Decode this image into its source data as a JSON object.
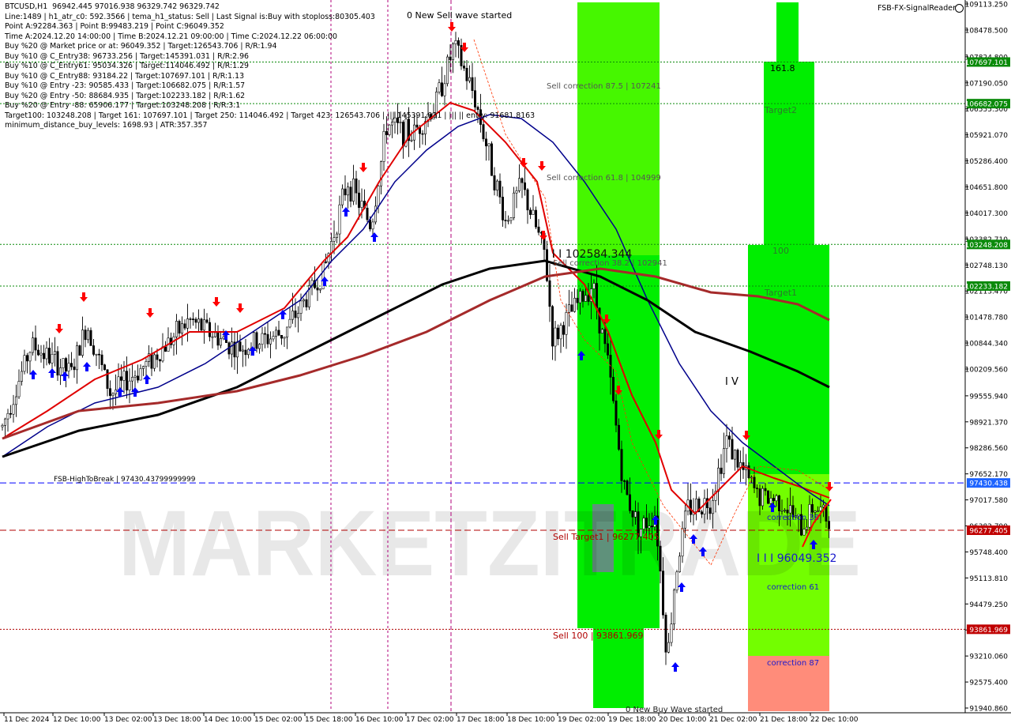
{
  "header": {
    "indicator_name": "FSB-FX-SignalReader",
    "info_lines": [
      "BTCUSD,H1  96942.445 97016.938 96329.742 96329.742",
      "Line:1489 | h1_atr_c0: 592.3566 | tema_h1_status: Sell | Last Signal is:Buy with stoploss:80305.403",
      "Point A:92284.363 | Point B:99483.219 | Point C:96049.352",
      "Time A:2024.12.20 14:00:00 | Time B:2024.12.21 09:00:00 | Time C:2024.12.22 06:00:00",
      "Buy %20 @ Market price or at: 96049.352 | Target:126543.706 | R/R:1.94",
      "Buy %10 @ C_Entry38: 96733.256 | Target:145391.031 | R/R:2.96",
      "Buy %10 @ C_Entry61: 95034.326 | Target:114046.492 | R/R:1.29",
      "Buy %10 @ C_Entry88: 93184.22 | Target:107697.101 | R/R:1.13",
      "Buy %10 @ Entry -23: 90585.433 | Target:106682.075 | R/R:1.57",
      "Buy %20 @ Entry -50: 88684.935 | Target:102233.182 | R/R:1.62",
      "Buy %20 @ Entry -88: 65906.177 | Target:103248.208 | R/R:3.1",
      "Target100: 103248.208 | Target 161: 107697.101 | Target 250: 114046.492 | Target 423: 126543.706 | ||| 145391.031 | ||| || entry: 91681.8163",
      "minimum_distance_buy_levels: 1698.93 | ATR:357.357"
    ],
    "watermark": "MARKETZITRADE"
  },
  "chart_data": {
    "type": "candlestick",
    "symbol": "BTCUSD",
    "timeframe": "H1",
    "price_axis": {
      "ticks": [
        "109113.250",
        "108478.500",
        "107824.800",
        "107190.050",
        "106555.300",
        "105921.070",
        "105286.400",
        "104651.800",
        "104017.300",
        "103382.710",
        "102748.130",
        "102113.470",
        "101478.780",
        "100844.340",
        "100209.560",
        "99555.940",
        "98921.370",
        "98286.560",
        "97652.170",
        "97017.580",
        "96382.790",
        "95748.400",
        "95113.810",
        "94479.250",
        "93844.650",
        "93210.060",
        "92575.400",
        "91940.860"
      ],
      "range": [
        91790,
        109300
      ]
    },
    "time_axis": {
      "labels": [
        "11 Dec 2024",
        "12 Dec 10:00",
        "13 Dec 02:00",
        "13 Dec 18:00",
        "14 Dec 10:00",
        "15 Dec 02:00",
        "15 Dec 18:00",
        "16 Dec 10:00",
        "17 Dec 02:00",
        "17 Dec 18:00",
        "18 Dec 10:00",
        "19 Dec 02:00",
        "19 Dec 18:00",
        "20 Dec 10:00",
        "21 Dec 02:00",
        "21 Dec 18:00",
        "22 Dec 10:00"
      ]
    },
    "levels": [
      {
        "price": 107697.101,
        "label": "107697.101",
        "color": "#0a8a0a",
        "style": "dotted"
      },
      {
        "price": 106682.075,
        "label": "106682.075",
        "color": "#0a8a0a",
        "style": "dotted"
      },
      {
        "price": 103248.208,
        "label": "103248.208",
        "color": "#0a8a0a",
        "style": "dotted"
      },
      {
        "price": 102233.182,
        "label": "102233.182",
        "color": "#0a8a0a",
        "style": "dotted"
      },
      {
        "price": 97430.438,
        "label": "97430.438",
        "color": "#0000ff",
        "style": "dashed"
      },
      {
        "price": 96277.405,
        "label": "96277.405",
        "color": "#b00000",
        "style": "dashed"
      },
      {
        "price": 93861.969,
        "label": "93861.969",
        "color": "#b00000",
        "style": "dotted"
      }
    ],
    "annotations": {
      "new_sell_wave_top": "0 New Sell wave started",
      "new_buy_wave_bottom": "0 New Buy Wave started",
      "sell_correction_875": "Sell correction 87.5 | 107241",
      "sell_correction_618": "Sell correction 61.8 | 104999",
      "sell_correction_382": "Sell correction 38.2 | 102941",
      "wave_iii_label": "I I I  102584.344",
      "sell_target1": "Sell Target1 | 96277.405",
      "sell_100": "Sell 100 | 93861.969",
      "fsb_high_to_break": "FSB-HighToBreak | 97430.43799999999",
      "wave_iv": "I V",
      "wave_iii_low": "I I I  96049.352",
      "label_1618": "161.8",
      "label_target2": "Target2",
      "label_100": "100",
      "label_target1": "Target1",
      "correction_38": "correction 38",
      "correction_61": "correction 61",
      "correction_87": "correction 87"
    },
    "colors": {
      "up_candle": "#000000",
      "down_candle": "#000000",
      "ma_fast": "#e00000",
      "ma_mid": "#00008b",
      "ma_slow": "#000000",
      "ma_long": "#a52a2a",
      "zone_bright": "#00ee00",
      "zone_lime": "#80ff00",
      "zone_salmon": "#ff8c7a",
      "zone_grey": "#708090",
      "buy_arrow": "#0000ff",
      "sell_arrow": "#ff0000"
    }
  }
}
